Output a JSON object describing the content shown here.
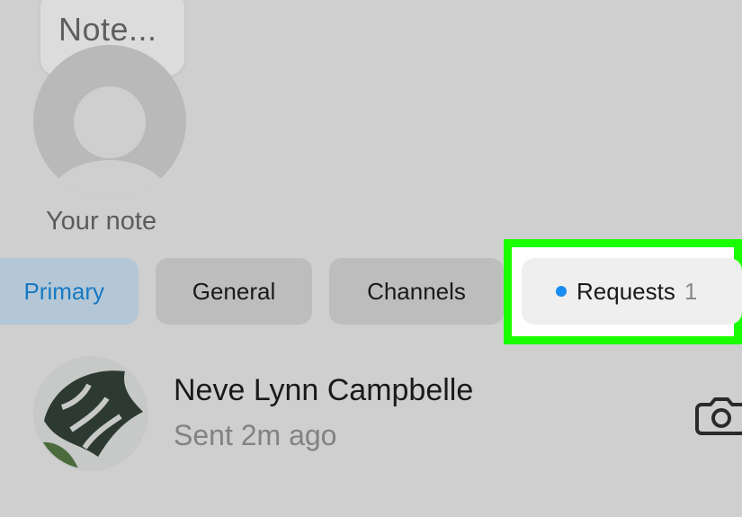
{
  "note": {
    "bubble_text": "Note...",
    "label": "Your note"
  },
  "tabs": [
    {
      "label": "Primary",
      "selected": true
    },
    {
      "label": "General",
      "selected": false
    },
    {
      "label": "Channels",
      "selected": false
    },
    {
      "label": "Requests",
      "count": "1",
      "has_unread_dot": true,
      "highlighted": true
    }
  ],
  "messages": [
    {
      "name": "Neve Lynn Campbelle",
      "status": "Sent 2m ago",
      "action_icon": "camera-icon"
    }
  ],
  "colors": {
    "background": "#cfcfcf",
    "primary_tab_text": "#1679c2",
    "highlight": "#1aff00",
    "unread_dot": "#1a8cf0"
  }
}
